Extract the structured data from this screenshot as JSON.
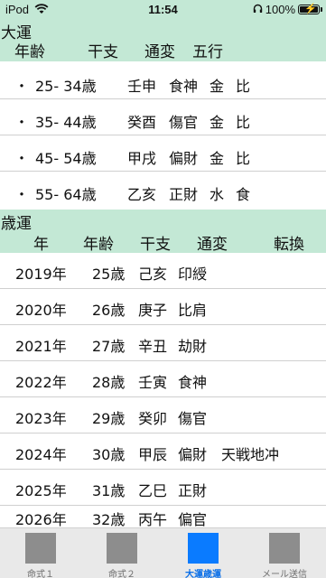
{
  "status_bar": {
    "carrier": "iPod",
    "time": "11:54",
    "battery": "100%",
    "battery_level": 1.0
  },
  "daiun": {
    "title": "大運",
    "columns": [
      "年齢",
      "干支",
      "通変",
      "五行"
    ],
    "rows": [
      {
        "bullet": "・",
        "age": "25- 34歳",
        "kanshi": "壬申",
        "tsuhen": "食神",
        "gogyo1": "金",
        "gogyo2": "比"
      },
      {
        "bullet": "・",
        "age": "35- 44歳",
        "kanshi": "癸酉",
        "tsuhen": "傷官",
        "gogyo1": "金",
        "gogyo2": "比"
      },
      {
        "bullet": "・",
        "age": "45- 54歳",
        "kanshi": "甲戌",
        "tsuhen": "偏財",
        "gogyo1": "金",
        "gogyo2": "比"
      },
      {
        "bullet": "・",
        "age": "55- 64歳",
        "kanshi": "乙亥",
        "tsuhen": "正財",
        "gogyo1": "水",
        "gogyo2": "食"
      }
    ]
  },
  "saiun": {
    "title": "歳運",
    "columns": [
      "年",
      "年齢",
      "干支",
      "通変",
      "転換"
    ],
    "rows": [
      {
        "year": "2019年",
        "age": "25歳",
        "kanshi": "己亥",
        "tsuhen": "印綬",
        "tenkan": ""
      },
      {
        "year": "2020年",
        "age": "26歳",
        "kanshi": "庚子",
        "tsuhen": "比肩",
        "tenkan": ""
      },
      {
        "year": "2021年",
        "age": "27歳",
        "kanshi": "辛丑",
        "tsuhen": "劫財",
        "tenkan": ""
      },
      {
        "year": "2022年",
        "age": "28歳",
        "kanshi": "壬寅",
        "tsuhen": "食神",
        "tenkan": ""
      },
      {
        "year": "2023年",
        "age": "29歳",
        "kanshi": "癸卯",
        "tsuhen": "傷官",
        "tenkan": ""
      },
      {
        "year": "2024年",
        "age": "30歳",
        "kanshi": "甲辰",
        "tsuhen": "偏財",
        "tenkan": "天戦地冲"
      },
      {
        "year": "2025年",
        "age": "31歳",
        "kanshi": "乙巳",
        "tsuhen": "正財",
        "tenkan": ""
      },
      {
        "year": "2026年",
        "age": "32歳",
        "kanshi": "丙午",
        "tsuhen": "偏官",
        "tenkan": ""
      }
    ]
  },
  "tab_bar": {
    "tabs": [
      {
        "label": "命式１",
        "icon": "meishiki1-icon",
        "active": false
      },
      {
        "label": "命式２",
        "icon": "meishiki2-icon",
        "active": false
      },
      {
        "label": "大運歳運",
        "icon": "daiun-saiun-icon",
        "active": true
      },
      {
        "label": "メール送信",
        "icon": "mail-send-icon",
        "active": false
      }
    ]
  },
  "colors": {
    "header_bg": "#c3e8d5",
    "accent": "#0a7bff",
    "tab_bg": "#e9e9e9",
    "inactive_icon": "#8d8d8d"
  }
}
